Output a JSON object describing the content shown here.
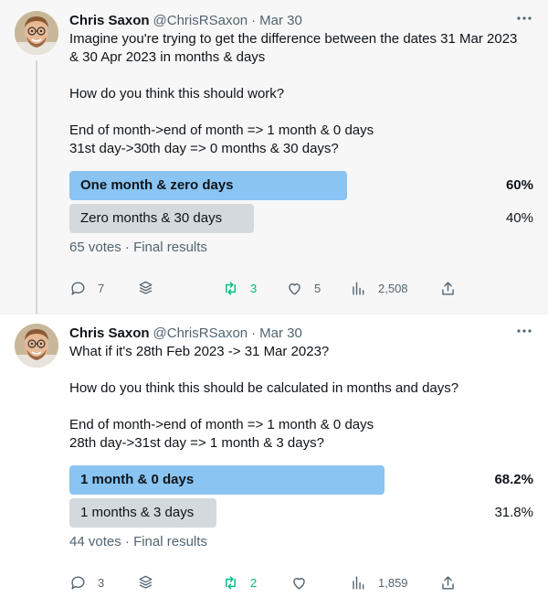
{
  "tweets": [
    {
      "name": "Chris Saxon",
      "handle": "@ChrisRSaxon",
      "separator": "·",
      "date": "Mar 30",
      "text_lines": [
        [
          "Imagine you're trying to get the difference between the dates 31 Mar 2023",
          "& 30 Apr 2023 in months & days"
        ],
        [
          "How do you think this should work?"
        ],
        [
          "End of month->end of month => 1 month & 0 days",
          "31st day->30th day => 0 months & 30 days?"
        ]
      ],
      "poll": {
        "options": [
          {
            "label": "One month & zero days",
            "percent_label": "60%",
            "percent": 60,
            "winner": true
          },
          {
            "label": "Zero months & 30 days",
            "percent_label": "40%",
            "percent": 40,
            "winner": false
          }
        ],
        "votes": "65 votes",
        "meta_separator": "·",
        "status": "Final results"
      },
      "actions": {
        "replies": "7",
        "retweets": "3",
        "likes": "5",
        "views": "2,508"
      }
    },
    {
      "name": "Chris Saxon",
      "handle": "@ChrisRSaxon",
      "separator": "·",
      "date": "Mar 30",
      "text_lines": [
        [
          "What if it's 28th Feb 2023 -> 31 Mar 2023?"
        ],
        [
          "How do you think this should be calculated in months and days?"
        ],
        [
          "End of month->end of month => 1 month & 0 days",
          "28th day->31st day => 1 month & 3 days?"
        ]
      ],
      "poll": {
        "options": [
          {
            "label": "1 month & 0 days",
            "percent_label": "68.2%",
            "percent": 68.2,
            "winner": true
          },
          {
            "label": "1 months & 3 days",
            "percent_label": "31.8%",
            "percent": 31.8,
            "winner": false
          }
        ],
        "votes": "44 votes",
        "meta_separator": "·",
        "status": "Final results"
      },
      "actions": {
        "replies": "3",
        "retweets": "2",
        "likes": "",
        "views": "1,859"
      }
    }
  ],
  "colors": {
    "winner_bar": "#8ac4f2",
    "loser_bar": "#d4d9dd",
    "retweet_green": "#00ba7c",
    "muted": "#536471"
  },
  "icons": [
    "more-icon",
    "reply-icon",
    "stack-icon",
    "retweet-icon",
    "like-icon",
    "views-icon",
    "share-icon"
  ]
}
